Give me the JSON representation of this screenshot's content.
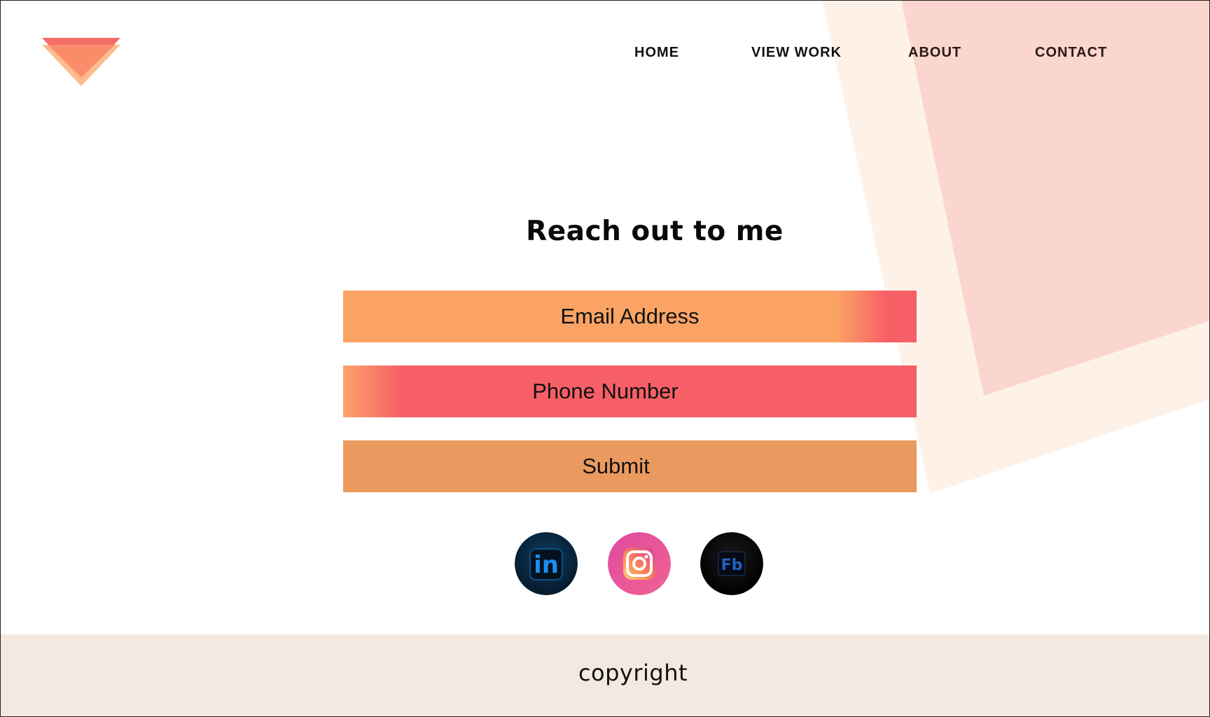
{
  "colors": {
    "accent_orange": "#fba365",
    "accent_coral": "#f75f66",
    "submit_orange": "#ea9a5e",
    "footer_bg": "#f4e9e0",
    "bg_shape_light": "#fef1e8",
    "bg_shape_pink": "#fad6cf"
  },
  "logo": {
    "icon": "triangle-logo-icon"
  },
  "nav": {
    "items": [
      {
        "label": "HOME"
      },
      {
        "label": "VIEW WORK"
      },
      {
        "label": "ABOUT"
      },
      {
        "label": "CONTACT"
      }
    ]
  },
  "contact": {
    "title": "Reach out to me",
    "email_placeholder": "Email Address",
    "phone_placeholder": "Phone Number",
    "submit_label": "Submit"
  },
  "socials": [
    {
      "icon": "linkedin-icon",
      "label": "in"
    },
    {
      "icon": "instagram-icon"
    },
    {
      "icon": "facebook-icon",
      "label": "Fb"
    }
  ],
  "footer": {
    "copyright": "copyright"
  }
}
